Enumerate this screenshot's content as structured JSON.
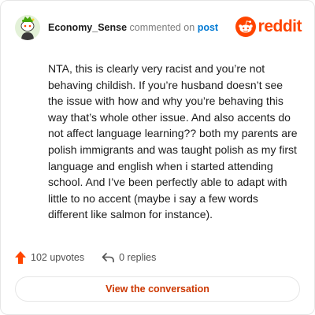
{
  "header": {
    "username": "Economy_Sense",
    "action_text": "commented on",
    "target_link": "post",
    "brand_wordmark": "reddit",
    "avatar_icon": "snoo-avatar-icon",
    "logo_icon": "reddit-alien-icon"
  },
  "comment": {
    "body": "NTA, this is clearly very racist and you’re not behaving childish. If you’re husband doesn’t see the issue with how and why you’re behaving this way that’s whole other issue. And also accents do not affect language learning?? both my parents are polish immigrants and was taught polish as my first language and english when i started attending school. And I’ve been perfectly able to adapt with little to no accent (maybe i say a few words different like salmon for instance)."
  },
  "stats": {
    "upvotes_label": "102 upvotes",
    "upvote_icon": "upvote-arrow-icon",
    "replies_label": "0 replies",
    "reply_icon": "reply-arrow-icon"
  },
  "cta": {
    "label": "View the conversation"
  },
  "colors": {
    "brand": "#ff4500",
    "link": "#0079d3",
    "cta_text": "#cc3700",
    "border": "#e6e6e6"
  }
}
